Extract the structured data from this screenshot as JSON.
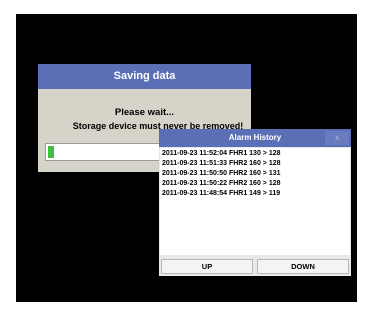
{
  "save_dialog": {
    "title": "Saving data",
    "wait_text": "Please wait...",
    "warning_text": "Storage device must never be removed!",
    "progress_fraction": 0.03
  },
  "alarm_dialog": {
    "title": "Alarm History",
    "close_label": "x",
    "entries": [
      "2011-09-23 11:52:04  FHR1 130 > 128",
      "2011-09-23 11:51:33  FHR2 160 > 128",
      "2011-09-23 11:50:50  FHR2 160 > 131",
      "2011-09-23 11:50:22  FHR2 160 > 128",
      "2011-09-23 11:48:54  FHR1 149 > 119"
    ],
    "up_label": "UP",
    "down_label": "DOWN"
  },
  "colors": {
    "title_bar": "#5b6fb7",
    "progress": "#3fbf3f",
    "background": "#000000"
  }
}
